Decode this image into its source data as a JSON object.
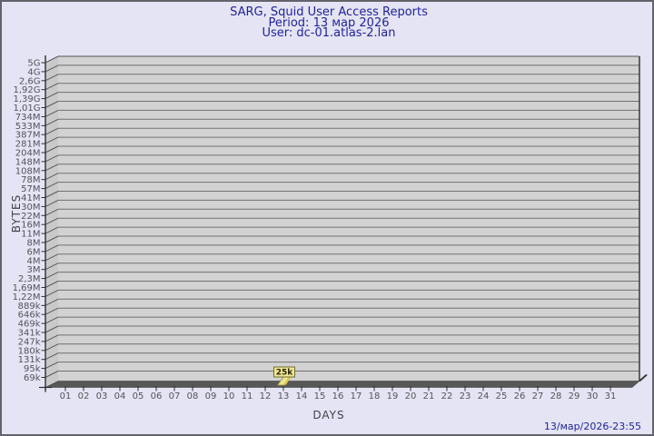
{
  "chart_data": {
    "type": "bar",
    "title": "SARG, Squid User Access Reports",
    "period_line": "Period: 13 мар 2026",
    "user_line": "User: dc-01.atlas-2.lan",
    "xlabel": "DAYS",
    "ylabel": "BYTES",
    "categories": [
      "01",
      "02",
      "03",
      "04",
      "05",
      "06",
      "07",
      "08",
      "09",
      "10",
      "11",
      "12",
      "13",
      "14",
      "15",
      "16",
      "17",
      "18",
      "19",
      "20",
      "21",
      "22",
      "23",
      "24",
      "25",
      "26",
      "27",
      "28",
      "29",
      "30",
      "31"
    ],
    "values": [
      0,
      0,
      0,
      0,
      0,
      0,
      0,
      0,
      0,
      0,
      0,
      0,
      25000,
      0,
      0,
      0,
      0,
      0,
      0,
      0,
      0,
      0,
      0,
      0,
      0,
      0,
      0,
      0,
      0,
      0,
      0
    ],
    "bar_value_label": "25k",
    "y_tick_labels": [
      "5G",
      "4G",
      "2,6G",
      "1,92G",
      "1,39G",
      "1,01G",
      "734M",
      "533M",
      "387M",
      "281M",
      "204M",
      "148M",
      "108M",
      "78M",
      "57M",
      "41M",
      "30M",
      "22M",
      "16M",
      "11M",
      "8M",
      "6M",
      "4M",
      "3M",
      "2,3M",
      "1,69M",
      "1,22M",
      "889k",
      "646k",
      "469k",
      "341k",
      "247k",
      "180k",
      "131k",
      "95k",
      "69k"
    ],
    "ylim": [
      0,
      5000000000
    ],
    "y_scale": "sarg-log",
    "grid": true,
    "legend_position": "none",
    "footer_timestamp": "13/мар/2026-23:55",
    "colors": {
      "background": "#e4e4f4",
      "title_text": "#22229b",
      "plot_band": "#d2d2d2",
      "gridline": "#717171",
      "wall": "#c9c9c9",
      "floor": "#575757",
      "axis_line": "#2e2e2e",
      "axis_text": "#54545c",
      "bar_fill": "#eee293",
      "bar_stripe": "#dfc94e",
      "bar_edge": "#9c9040",
      "value_box_bg": "#f0e692",
      "value_box_border": "#6f6f33",
      "value_box_text": "#26260a"
    }
  }
}
